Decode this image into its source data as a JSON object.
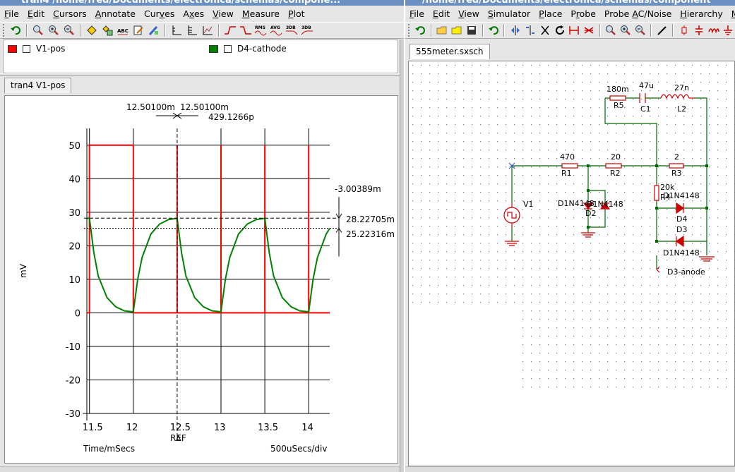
{
  "left_window": {
    "title": "tran4 /home/fred/Documents/electronica/schemas/compone...",
    "menu": [
      {
        "pre": "",
        "u": "F",
        "post": "ile"
      },
      {
        "pre": "",
        "u": "E",
        "post": "dit"
      },
      {
        "pre": "",
        "u": "C",
        "post": "ursors"
      },
      {
        "pre": "",
        "u": "A",
        "post": "nnotate"
      },
      {
        "pre": "Cur",
        "u": "v",
        "post": "es"
      },
      {
        "pre": "A",
        "u": "x",
        "post": "es"
      },
      {
        "pre": "",
        "u": "V",
        "post": "iew"
      },
      {
        "pre": "",
        "u": "M",
        "post": "easure"
      },
      {
        "pre": "",
        "u": "P",
        "post": "lot"
      }
    ],
    "toolbar_icons": [
      "undo-icon",
      "zoom-fit-icon",
      "zoom-in-icon",
      "zoom-out-icon",
      "cursor-icon",
      "cursor-pair-icon",
      "abc-icon",
      "edit-icon",
      "pen-icon",
      "axis-icon",
      "axis2-icon",
      "grid-icon",
      "rise-icon",
      "fall-icon",
      "rms-icon",
      "avg-icon",
      "3db-icon",
      "3db2-icon"
    ],
    "toolbar_text": {
      "rms": "RMS",
      "avg": "AVG",
      "db1": "3DB",
      "db2": "3DB"
    },
    "legend": [
      {
        "name": "V1-pos",
        "color": "#ff0000"
      },
      {
        "name": "D4-cathode",
        "color": "#008000"
      }
    ],
    "tab": "tran4 V1-pos",
    "cursors": {
      "c1": "12.50100m",
      "c2": "12.50100m",
      "delta_x": "429.1266p",
      "y1": "28.22705m",
      "y2": "25.22316m",
      "delta_y": "-3.00389m"
    },
    "ref_label": "REF",
    "cursor_marker": "A",
    "x_axis_title": "Time/mSecs",
    "x_scale": "500uSecs/div",
    "y_axis_title": "mV"
  },
  "chart_data": {
    "type": "line",
    "xlabel": "Time/mSecs",
    "ylabel": "mV",
    "xlim": [
      11.47,
      14.24
    ],
    "ylim": [
      -30,
      55
    ],
    "x_ticks": [
      "11.5",
      "12",
      "12.5",
      "13",
      "13.5",
      "14"
    ],
    "y_ticks": [
      "50",
      "40",
      "30",
      "20",
      "10",
      "0",
      "-10",
      "-20",
      "-30"
    ],
    "series": [
      {
        "name": "V1-pos",
        "color": "#ff0000",
        "x": [
          11.47,
          11.5,
          11.5,
          12.0,
          12.0,
          12.0,
          12.5,
          12.5,
          12.5,
          13.0,
          13.0,
          13.0,
          13.5,
          13.5,
          13.5,
          14.0,
          14.0,
          14.0,
          14.24
        ],
        "y": [
          0,
          0,
          50,
          50,
          0,
          0,
          0,
          50,
          0,
          0,
          50,
          0,
          0,
          50,
          0,
          0,
          50,
          0,
          0
        ]
      },
      {
        "name": "D4-cathode",
        "color": "#008000",
        "x": [
          11.47,
          11.5,
          11.55,
          11.6,
          11.7,
          11.8,
          11.9,
          12.0,
          12.05,
          12.1,
          12.2,
          12.3,
          12.4,
          12.5,
          12.55,
          12.6,
          12.7,
          12.8,
          12.9,
          13.0,
          13.05,
          13.1,
          13.2,
          13.3,
          13.4,
          13.5,
          13.55,
          13.6,
          13.7,
          13.8,
          13.9,
          14.0,
          14.05,
          14.1,
          14.2,
          14.24
        ],
        "y": [
          28.2,
          28.2,
          18,
          11,
          4.5,
          1.8,
          0.6,
          0.3,
          10,
          16.5,
          23.5,
          26.5,
          27.8,
          28.2,
          18,
          11,
          4.5,
          1.8,
          0.6,
          0.3,
          10,
          16.5,
          23.5,
          26.5,
          27.8,
          28.2,
          18,
          11,
          4.5,
          1.8,
          0.6,
          0.3,
          10,
          16.5,
          23.5,
          25.2
        ]
      }
    ]
  },
  "right_window": {
    "title": "/home/fred/Documents/electronica/schemas/component",
    "menu": [
      {
        "pre": "",
        "u": "F",
        "post": "ile"
      },
      {
        "pre": "",
        "u": "E",
        "post": "dit"
      },
      {
        "pre": "",
        "u": "V",
        "post": "iew"
      },
      {
        "pre": "",
        "u": "S",
        "post": "imulator"
      },
      {
        "pre": "",
        "u": "P",
        "post": "lace"
      },
      {
        "pre": "P",
        "u": "r",
        "post": "obe"
      },
      {
        "pre": "Probe ",
        "u": "A",
        "post": "C/Noise"
      },
      {
        "pre": "",
        "u": "H",
        "post": "ierarchy"
      },
      {
        "pre": "",
        "u": "M",
        "post": "onte-"
      }
    ],
    "toolbar_icons": [
      "undo-icon",
      "open-icon",
      "folder-icon",
      "save-icon",
      "undo2-icon",
      "mirror-icon",
      "rotate-icon",
      "cut-icon",
      "refresh-icon",
      "wire-icon",
      "wire2-icon",
      "zoom-fit-icon",
      "zoom-in-icon",
      "zoom-out-icon",
      "pencil-icon",
      "resistor-icon",
      "capacitor-icon",
      "inductor-icon",
      "ground-icon"
    ],
    "tab": "555meter.sxsch",
    "components": {
      "r5_val": "180m",
      "r5": "R5",
      "c1_val": "47u",
      "c1": "C1",
      "l2_val": "27n",
      "l2": "L2",
      "r1_val": "470",
      "r1": "R1",
      "r2_val": "20",
      "r2": "R2",
      "r3_val": "2",
      "r3": "R3",
      "r4_val": "20k",
      "r4": "R4",
      "v1": "V1",
      "d1": "D1N4148",
      "d2": "D2",
      "d2b": "D1N4148",
      "d4_model": "D1N4148",
      "d4": "D4",
      "d3": "D3",
      "d3_model": "D1N4148",
      "probe": "D3-anode"
    }
  }
}
